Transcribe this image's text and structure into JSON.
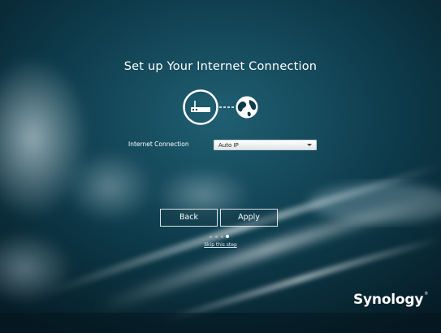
{
  "page": {
    "title": "Set up Your Internet Connection"
  },
  "form": {
    "internet_connection_label": "Internet Connection",
    "internet_connection_value": "Auto IP"
  },
  "buttons": {
    "back": "Back",
    "apply": "Apply"
  },
  "steps": {
    "total": 4,
    "current": 4
  },
  "skip_link": "Skip this step",
  "brand": {
    "name": "Synology",
    "registered": "®"
  },
  "icons": [
    "router-icon",
    "globe-icon"
  ],
  "colors": {
    "background": "#0a2e3b",
    "accent": "#1e6f86"
  }
}
